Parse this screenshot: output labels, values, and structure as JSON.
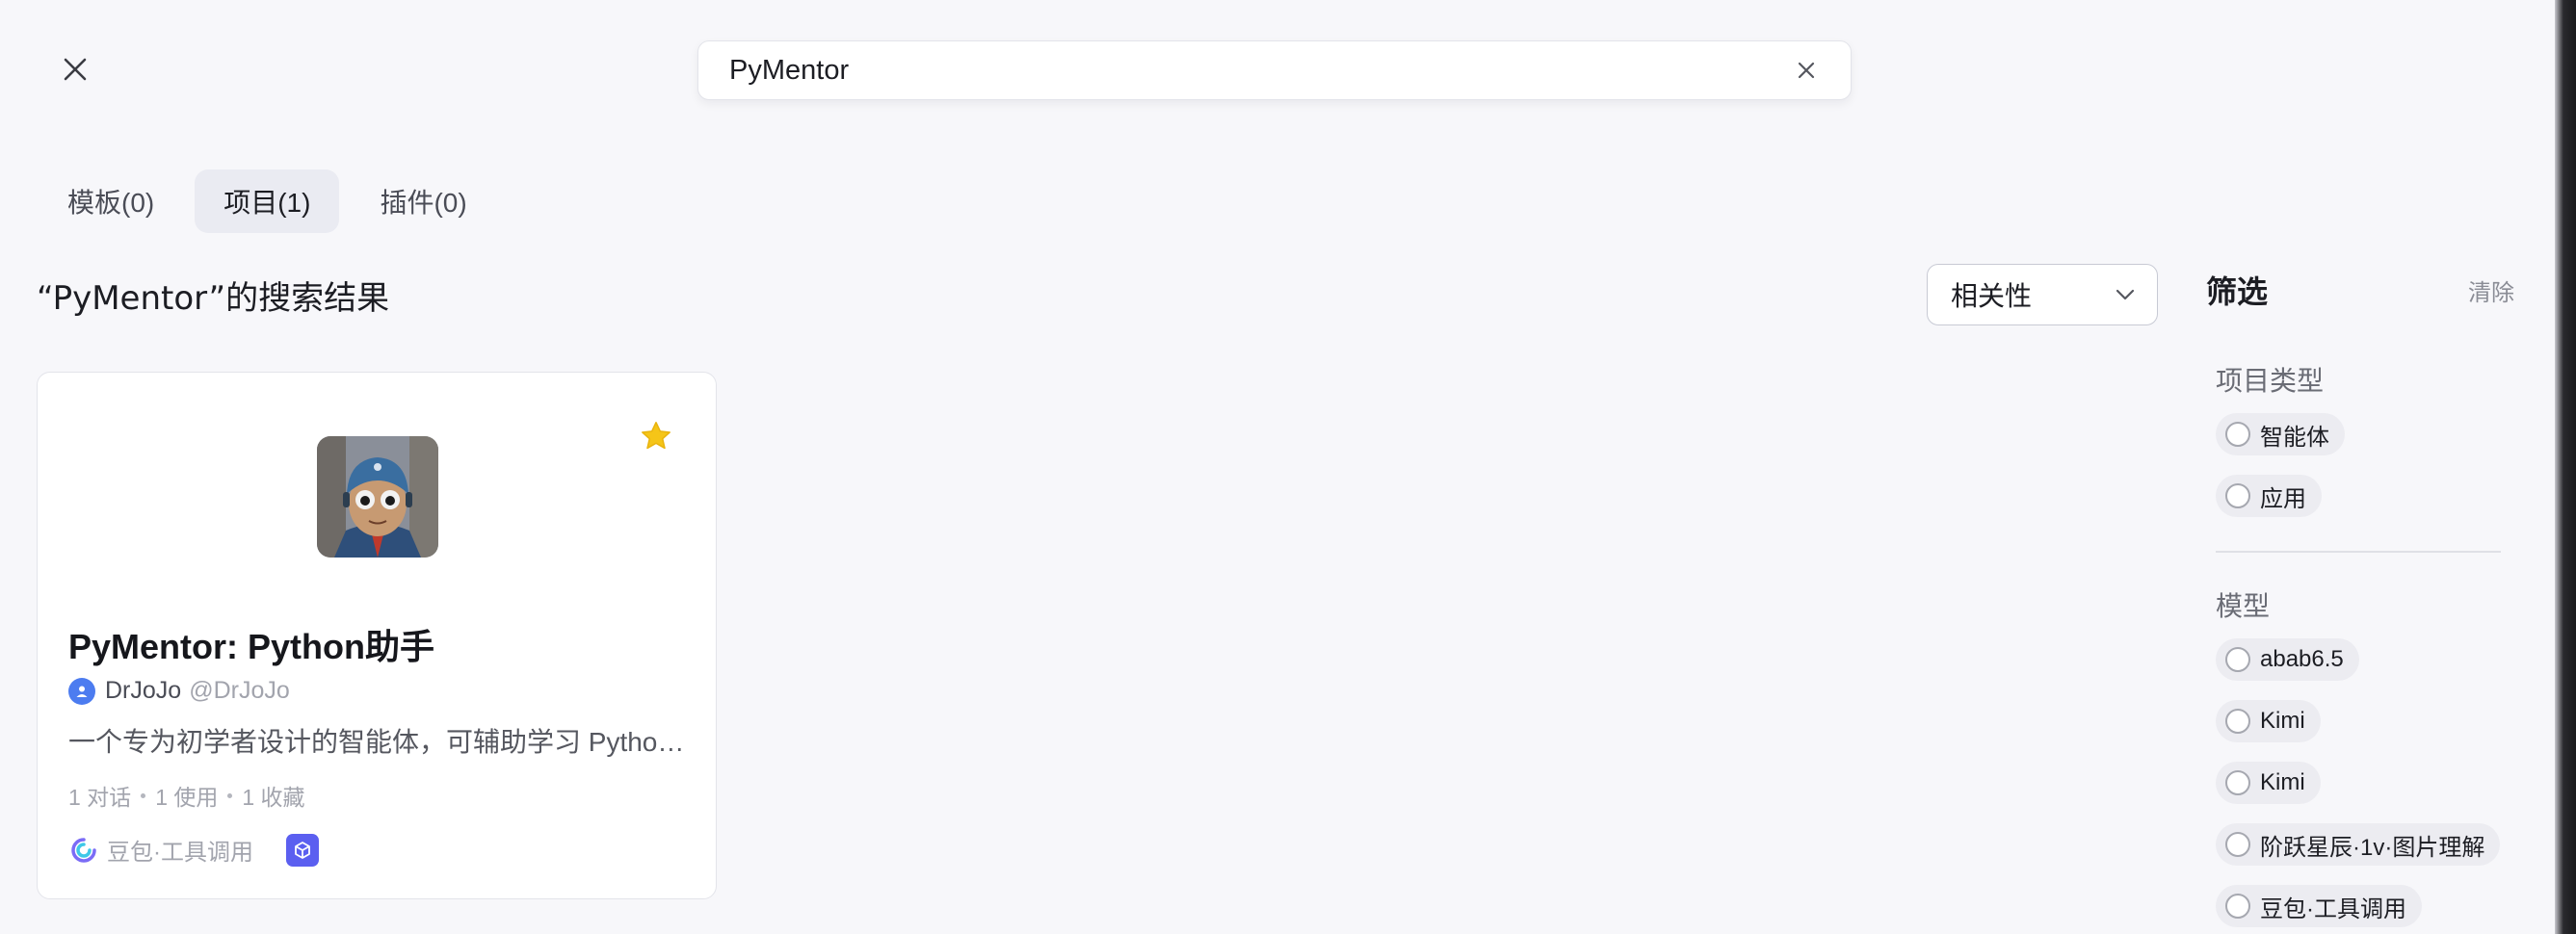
{
  "search": {
    "value": "PyMentor",
    "placeholder": ""
  },
  "tabs": [
    {
      "label": "模板(0)"
    },
    {
      "label": "项目(1)",
      "active": true
    },
    {
      "label": "插件(0)"
    }
  ],
  "results_title": "“PyMentor”的搜索结果",
  "sort": {
    "selected": "相关性"
  },
  "card": {
    "title": "PyMentor: Python助手",
    "author_name": "DrJoJo",
    "author_handle": "@DrJoJo",
    "description": "一个专为初学者设计的智能体，可辅助学习 Python编程基础知识",
    "stats": [
      "1 对话",
      "1 使用",
      "1 收藏"
    ],
    "model": "豆包·工具调用",
    "favorited": true
  },
  "filter": {
    "title": "筛选",
    "clear_label": "清除",
    "project_type_label": "项目类型",
    "project_types": [
      "智能体",
      "应用"
    ],
    "model_label": "模型",
    "models": [
      "abab6.5",
      "Kimi",
      "Kimi",
      "阶跃星辰·1v·图片理解",
      "豆包·工具调用"
    ]
  },
  "colors": {
    "accent_star": "#f5c518",
    "plugin_badge": "#5b5ff0",
    "author_avatar": "#4c7cf0"
  }
}
